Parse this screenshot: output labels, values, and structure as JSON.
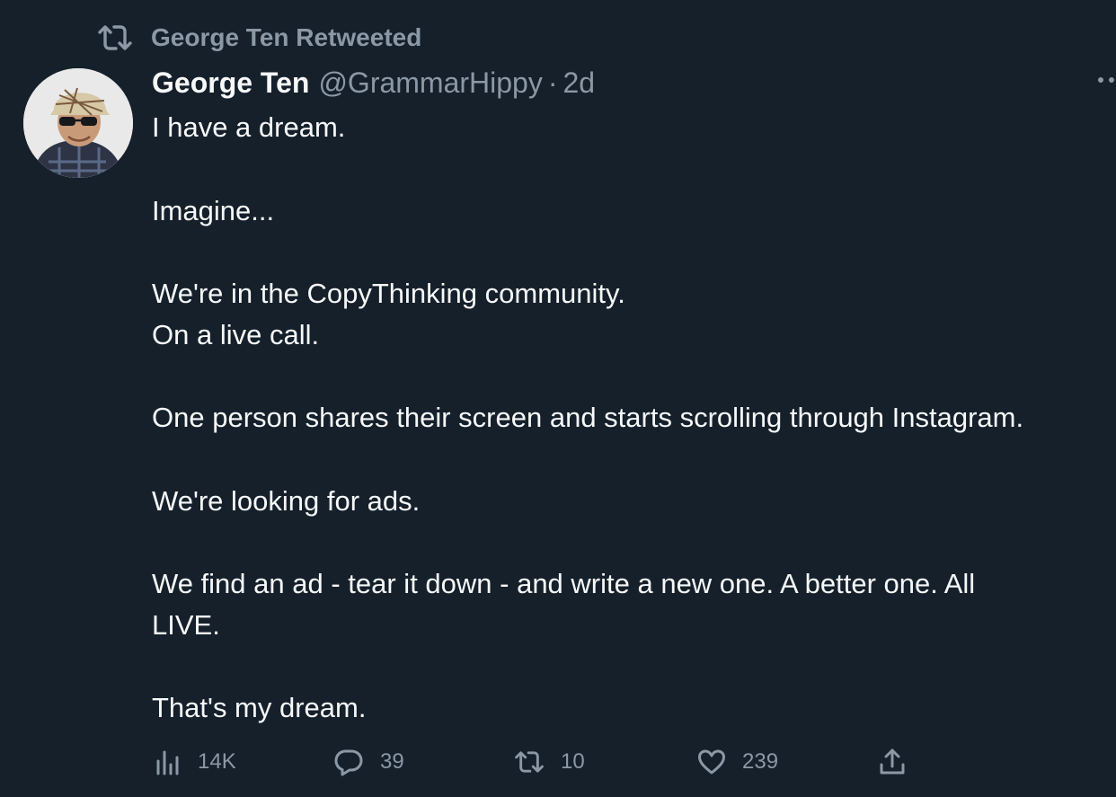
{
  "retweet_context": {
    "icon": "retweet-icon",
    "text": "George Ten Retweeted"
  },
  "author": {
    "display_name": "George Ten",
    "handle": "@GrammarHippy",
    "separator": "·",
    "time": "2d"
  },
  "tweet": {
    "lines": [
      "I have a dream.",
      "Imagine...",
      "We're in the CopyThinking community.",
      "On a live call.",
      "One person shares their screen and starts scrolling through Instagram.",
      "We're looking for ads.",
      "We find an ad - tear it down - and write a new one. A better one. All",
      "LIVE.",
      "That's my dream."
    ]
  },
  "actions": {
    "views": {
      "icon": "views-icon",
      "count": "14K"
    },
    "replies": {
      "icon": "reply-icon",
      "count": "39"
    },
    "retweets": {
      "icon": "retweet-icon",
      "count": "10"
    },
    "likes": {
      "icon": "heart-icon",
      "count": "239"
    },
    "share": {
      "icon": "share-icon"
    }
  },
  "colors": {
    "background": "#15202b",
    "primary_text": "#f7f9f9",
    "secondary_text": "#8b98a5"
  }
}
